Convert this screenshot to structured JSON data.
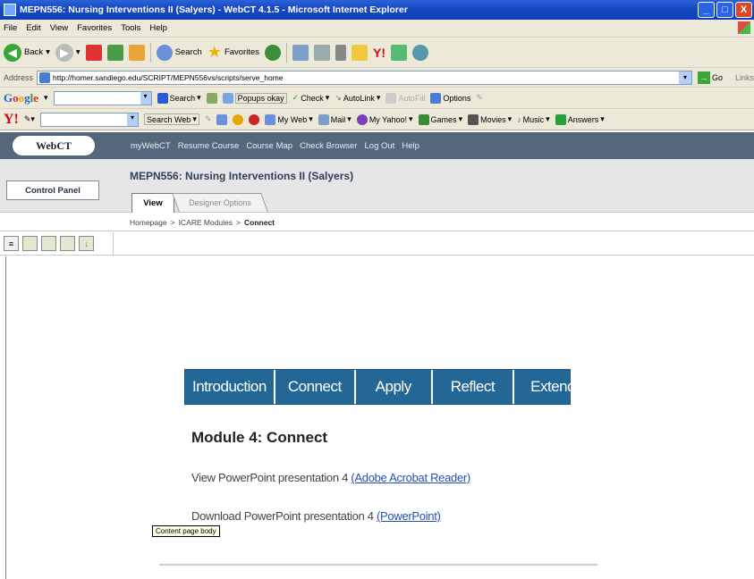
{
  "window": {
    "title": "MEPN556: Nursing Interventions II (Salyers) - WebCT 4.1.5 - Microsoft Internet Explorer",
    "minimize": "_",
    "maximize": "□",
    "close": "X"
  },
  "menu": [
    "File",
    "Edit",
    "View",
    "Favorites",
    "Tools",
    "Help"
  ],
  "toolbar": {
    "back": "Back",
    "search": "Search",
    "favorites": "Favorites"
  },
  "address": {
    "label": "Address",
    "url": "http://homer.sandiego.edu/SCRIPT/MEPN556vs/scripts/serve_home",
    "go": "Go",
    "links": "Links"
  },
  "google": {
    "logo_g": "G",
    "logo_o1": "o",
    "logo_o2": "o",
    "logo_g2": "g",
    "logo_l": "l",
    "logo_e": "e",
    "search": "Search",
    "popups": "Popups okay",
    "check": "Check",
    "autolink": "AutoLink",
    "autofill": "AutoFill",
    "options": "Options"
  },
  "yahoo": {
    "logo": "Y!",
    "search_web": "Search Web",
    "my_web": "My Web",
    "mail": "Mail",
    "my_yahoo": "My Yahoo!",
    "games": "Games",
    "movies": "Movies",
    "music": "Music",
    "answers": "Answers"
  },
  "webct": {
    "logo": "WebCT",
    "nav": [
      "myWebCT",
      "Resume Course",
      "Course Map",
      "Check Browser",
      "Log Out",
      "Help"
    ],
    "control_panel": "Control Panel",
    "course_title": "MEPN556: Nursing Interventions II (Salyers)",
    "tab_view": "View",
    "tab_designer": "Designer Options",
    "breadcrumb": {
      "home": "Homepage",
      "sep1": ">",
      "modules": "ICARE Modules",
      "sep2": ">",
      "current": "Connect"
    }
  },
  "module_nav": [
    "Introduction",
    "Connect",
    "Apply",
    "Reflect",
    "Extend"
  ],
  "module": {
    "heading": "Module 4: Connect",
    "line1_text": "View PowerPoint presentation 4 ",
    "line1_link": "(Adobe Acrobat Reader)",
    "line2_text": "Download PowerPoint presentation 4 ",
    "line2_link": "(PowerPoint)",
    "tooltip": "Content page body"
  }
}
